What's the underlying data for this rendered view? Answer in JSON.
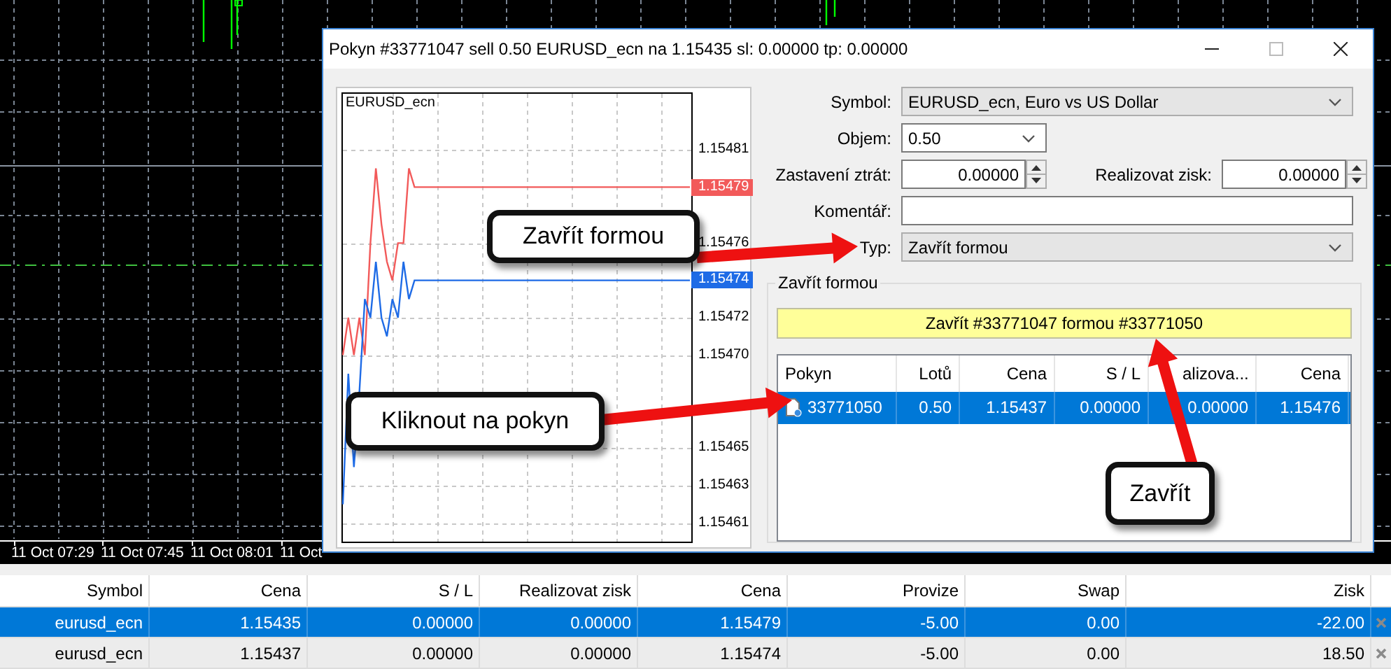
{
  "background_chart": {
    "time_labels": [
      "11 Oct 07:29",
      "11 Oct 07:45",
      "11 Oct 08:01",
      "11 Oct"
    ]
  },
  "dialog": {
    "title": "Pokyn #33771047 sell 0.50 EURUSD_ecn na 1.15435 sl: 0.00000 tp: 0.00000",
    "chart": {
      "ask_badge": "1.15479",
      "bid_badge": "1.15474",
      "chart_data": {
        "type": "line",
        "title": "EURUSD_ecn",
        "categories": [
          null,
          null,
          null,
          null,
          null,
          null,
          null,
          null,
          null,
          null,
          null,
          null,
          null,
          null,
          null,
          null,
          null,
          null,
          null,
          null,
          null,
          null,
          null,
          null,
          null,
          null,
          null,
          null,
          null,
          null,
          null,
          null,
          null,
          null,
          null,
          null,
          null,
          null,
          null,
          null,
          null,
          null,
          null,
          null,
          null,
          null,
          null,
          null,
          null,
          null,
          null,
          null,
          null,
          null,
          null,
          null,
          null,
          null,
          null,
          null,
          null,
          null,
          null,
          null
        ],
        "ylim": [
          1.1546,
          1.15484
        ],
        "grid": true,
        "yticks": [
          {
            "value": 1.15481,
            "label": "1.15481"
          },
          {
            "value": 1.15476,
            "label": "1.15476"
          },
          {
            "value": 1.15472,
            "label": "1.15472"
          },
          {
            "value": 1.1547,
            "label": "1.15470"
          },
          {
            "value": 1.15465,
            "label": "1.15465"
          },
          {
            "value": 1.15463,
            "label": "1.15463"
          },
          {
            "value": 1.15461,
            "label": "1.15461"
          }
        ],
        "series": [
          {
            "color": "#f25a5a",
            "values": [
              1.1547,
              1.15472,
              1.1547,
              1.15472,
              1.1547,
              1.15476,
              1.1548,
              1.15477,
              1.15475,
              1.15474,
              1.15476,
              1.15476,
              1.1548,
              1.15479,
              1.15479,
              1.15479,
              1.15479,
              1.15479,
              1.15479,
              1.15479,
              1.15479,
              1.15479,
              1.15479,
              1.15479,
              1.15479,
              1.15479,
              1.15479,
              1.15479,
              1.15479,
              1.15479,
              1.15479,
              1.15479,
              1.15479,
              1.15479,
              1.15479,
              1.15479,
              1.15479,
              1.15479,
              1.15479,
              1.15479,
              1.15479,
              1.15479,
              1.15479,
              1.15479,
              1.15479,
              1.15479,
              1.15479,
              1.15479,
              1.15479,
              1.15479,
              1.15479,
              1.15479,
              1.15479,
              1.15479,
              1.15479,
              1.15479,
              1.15479,
              1.15479,
              1.15479,
              1.15479,
              1.15479,
              1.15479,
              1.15479,
              1.15479
            ]
          },
          {
            "color": "#1e6be6",
            "values": [
              1.15462,
              1.15469,
              1.15464,
              1.15468,
              1.15473,
              1.15472,
              1.15475,
              1.15472,
              1.15471,
              1.15473,
              1.15472,
              1.15475,
              1.15473,
              1.15474,
              1.15474,
              1.15474,
              1.15474,
              1.15474,
              1.15474,
              1.15474,
              1.15474,
              1.15474,
              1.15474,
              1.15474,
              1.15474,
              1.15474,
              1.15474,
              1.15474,
              1.15474,
              1.15474,
              1.15474,
              1.15474,
              1.15474,
              1.15474,
              1.15474,
              1.15474,
              1.15474,
              1.15474,
              1.15474,
              1.15474,
              1.15474,
              1.15474,
              1.15474,
              1.15474,
              1.15474,
              1.15474,
              1.15474,
              1.15474,
              1.15474,
              1.15474,
              1.15474,
              1.15474,
              1.15474,
              1.15474,
              1.15474,
              1.15474,
              1.15474,
              1.15474,
              1.15474,
              1.15474,
              1.15474,
              1.15474,
              1.15474,
              1.15474
            ]
          }
        ]
      }
    },
    "symbol": {
      "label": "Symbol:",
      "value": "EURUSD_ecn, Euro vs US Dollar"
    },
    "volume": {
      "label": "Objem:",
      "value": "0.50"
    },
    "stop_loss": {
      "label": "Zastavení ztrát:",
      "value": "0.00000"
    },
    "take_profit": {
      "label": "Realizovat zisk:",
      "value": "0.00000"
    },
    "comment": {
      "label": "Komentář:"
    },
    "type": {
      "label": "Typ:",
      "value": "Zavřít formou"
    },
    "close_by": {
      "title": "Zavřít formou",
      "button": "Zavřít #33771047 formou #33771050",
      "columns": [
        "Pokyn",
        "Lotů",
        "Cena",
        "S / L",
        "alizova...",
        "Cena"
      ],
      "orders": [
        {
          "cells": [
            "33771050",
            "0.50",
            "1.15437",
            "0.00000",
            "0.00000",
            "1.15476"
          ],
          "selected": true
        }
      ]
    }
  },
  "callouts": [
    {
      "text": "Zavřít formou"
    },
    {
      "text": "Kliknout na pokyn"
    },
    {
      "text": "Zavřít"
    }
  ],
  "terminal": {
    "columns": [
      "Symbol",
      "Cena",
      "S / L",
      "Realizovat zisk",
      "Cena",
      "Provize",
      "Swap",
      "Zisk"
    ],
    "rows": [
      {
        "cells": [
          "eurusd_ecn",
          "1.15435",
          "0.00000",
          "0.00000",
          "1.15479",
          "-5.00",
          "0.00",
          "-22.00"
        ],
        "selected": true
      },
      {
        "cells": [
          "eurusd_ecn",
          "1.15437",
          "0.00000",
          "0.00000",
          "1.15474",
          "-5.00",
          "0.00",
          "18.50"
        ],
        "selected": false
      }
    ]
  }
}
